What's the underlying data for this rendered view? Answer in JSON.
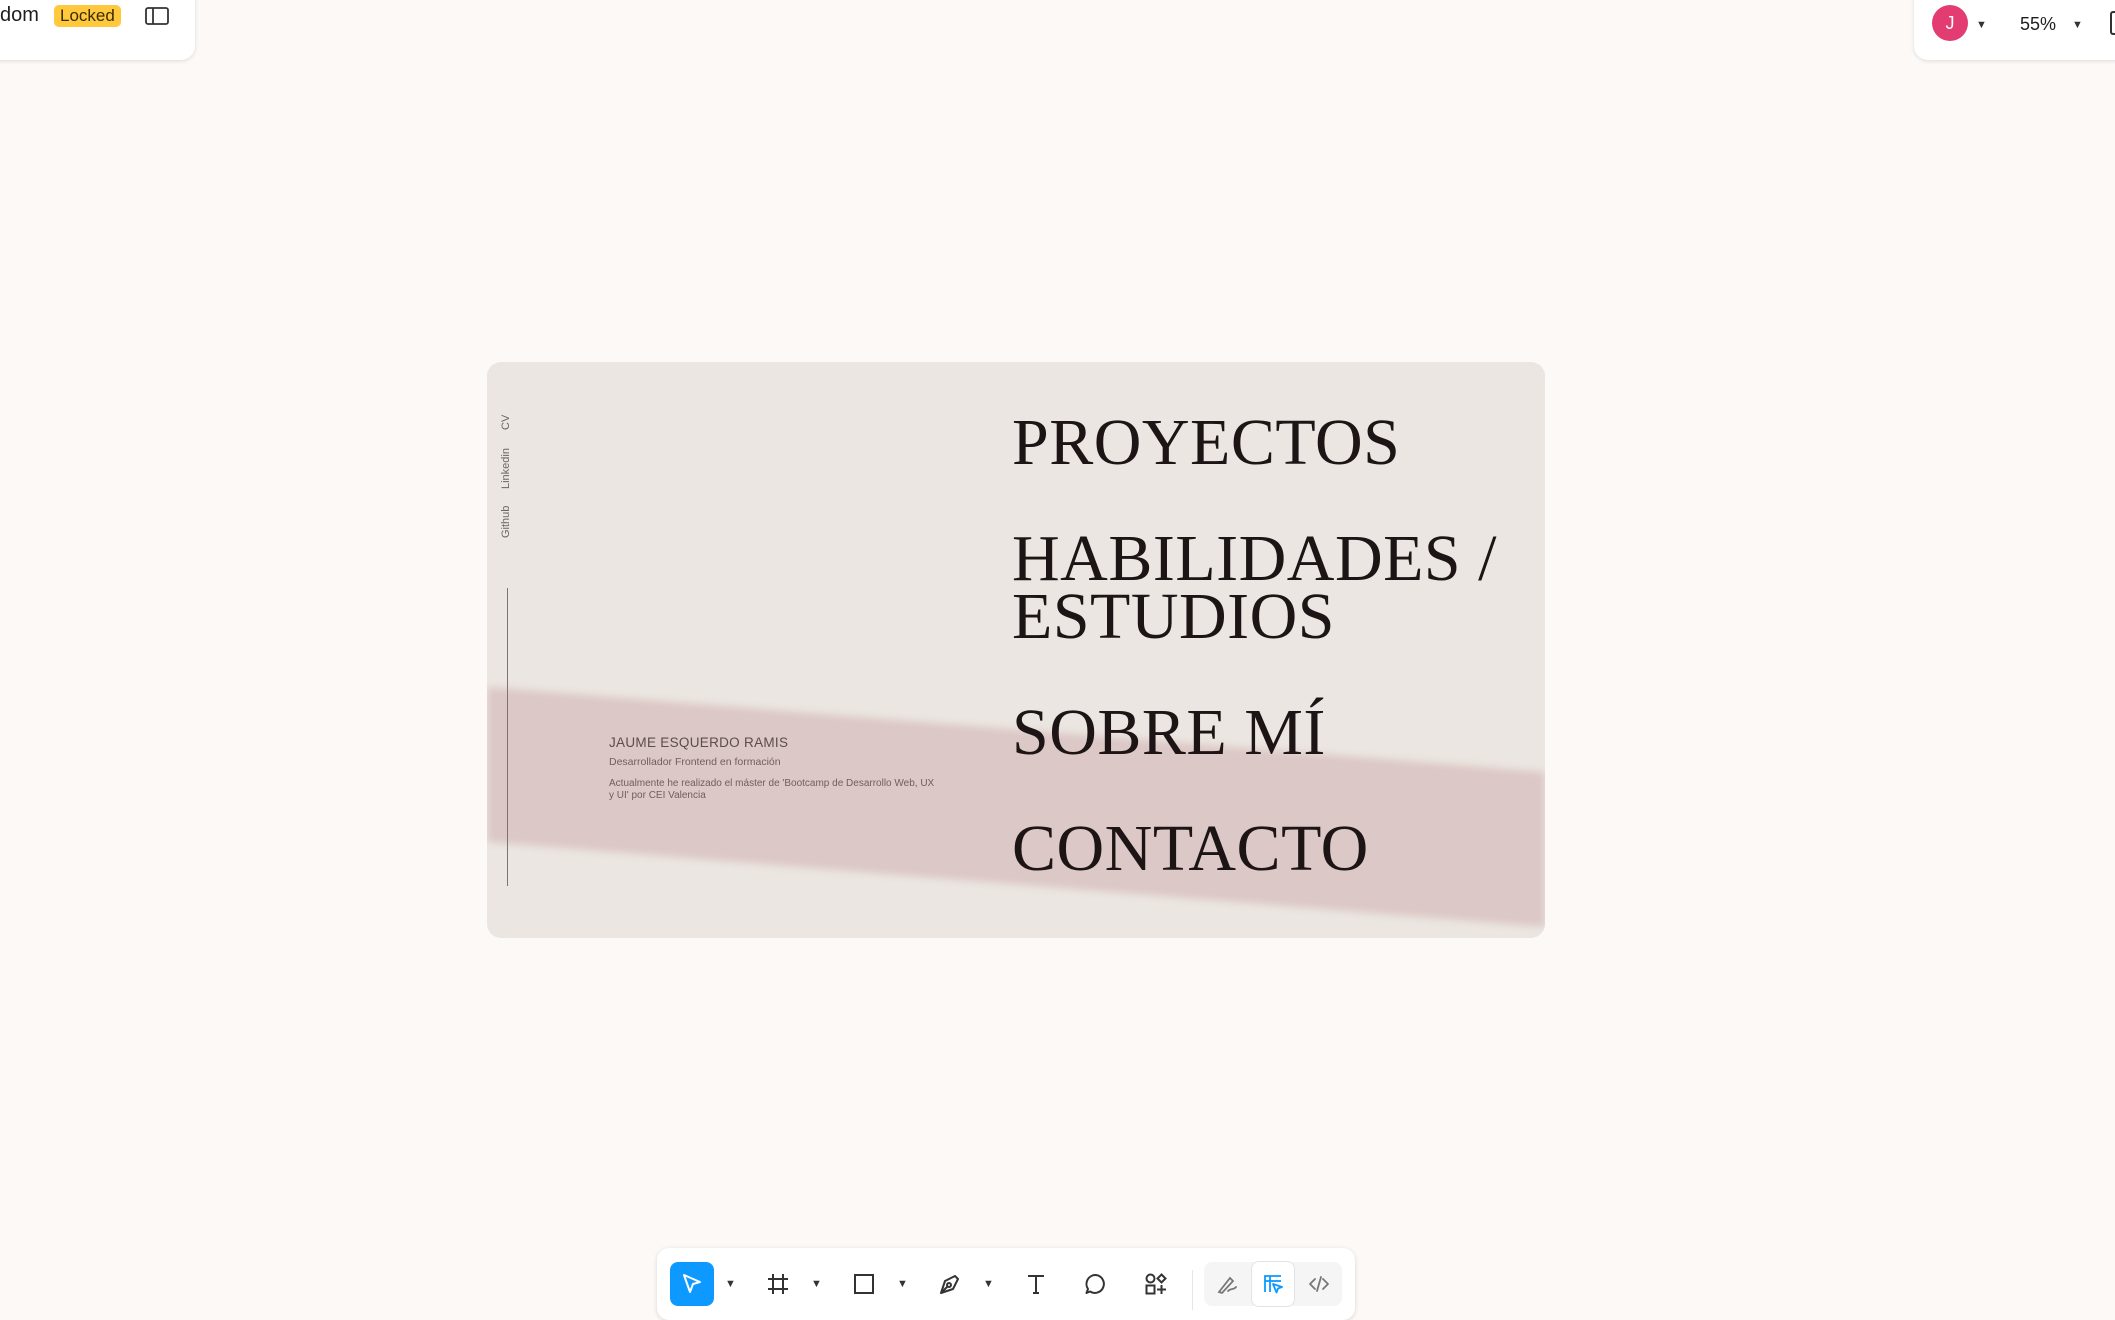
{
  "header": {
    "file_title": "dom",
    "status_badge": "Locked",
    "avatar_initial": "J",
    "zoom_level": "55%"
  },
  "frame": {
    "side_links": [
      "Github",
      "Linkedin",
      "CV"
    ],
    "person": {
      "name": "JAUME ESQUERDO RAMIS",
      "role": "Desarrollador Frontend en formación",
      "description": "Actualmente he realizado el máster de 'Bootcamp de Desarrollo Web, UX y UI' por CEI Valencia"
    },
    "menu": {
      "item_1": "PROYECTOS",
      "item_2_line_1": "HABILIDADES /",
      "item_2_line_2": "ESTUDIOS",
      "item_3": "SOBRE MÍ",
      "item_4": "CONTACTO"
    }
  },
  "toolbar": {
    "tools": [
      "move-tool",
      "frame-tool",
      "rectangle-tool",
      "pen-tool",
      "text-tool",
      "comment-tool",
      "actions-tool"
    ],
    "modes": [
      "draw-mode",
      "design-mode",
      "dev-mode"
    ],
    "active_tool": "move-tool",
    "active_mode": "design-mode"
  },
  "colors": {
    "accent": "#0d99ff",
    "badge": "#ffc83d",
    "avatar": "#e23c73",
    "frame_bg": "#ebe6e1",
    "band": "#dcc8c6"
  }
}
